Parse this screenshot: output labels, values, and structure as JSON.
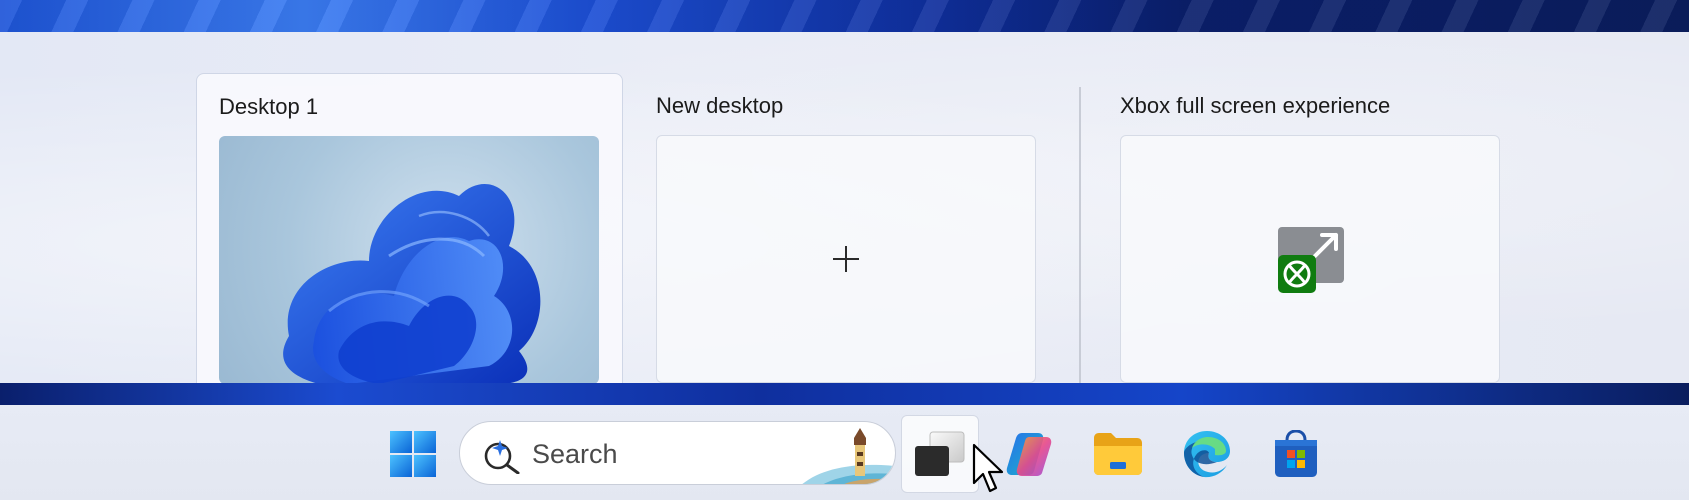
{
  "task_view": {
    "desktops": [
      {
        "label": "Desktop 1",
        "selected": true
      },
      {
        "label": "New desktop"
      },
      {
        "label": "Xbox full screen experience"
      }
    ]
  },
  "taskbar": {
    "search_placeholder": "Search",
    "icons": [
      "start-icon",
      "search-icon",
      "task-view-icon",
      "copilot-icon",
      "file-explorer-icon",
      "edge-icon",
      "store-icon"
    ]
  },
  "colors": {
    "accent": "#1d5fc4",
    "xbox_green": "#107c10"
  }
}
